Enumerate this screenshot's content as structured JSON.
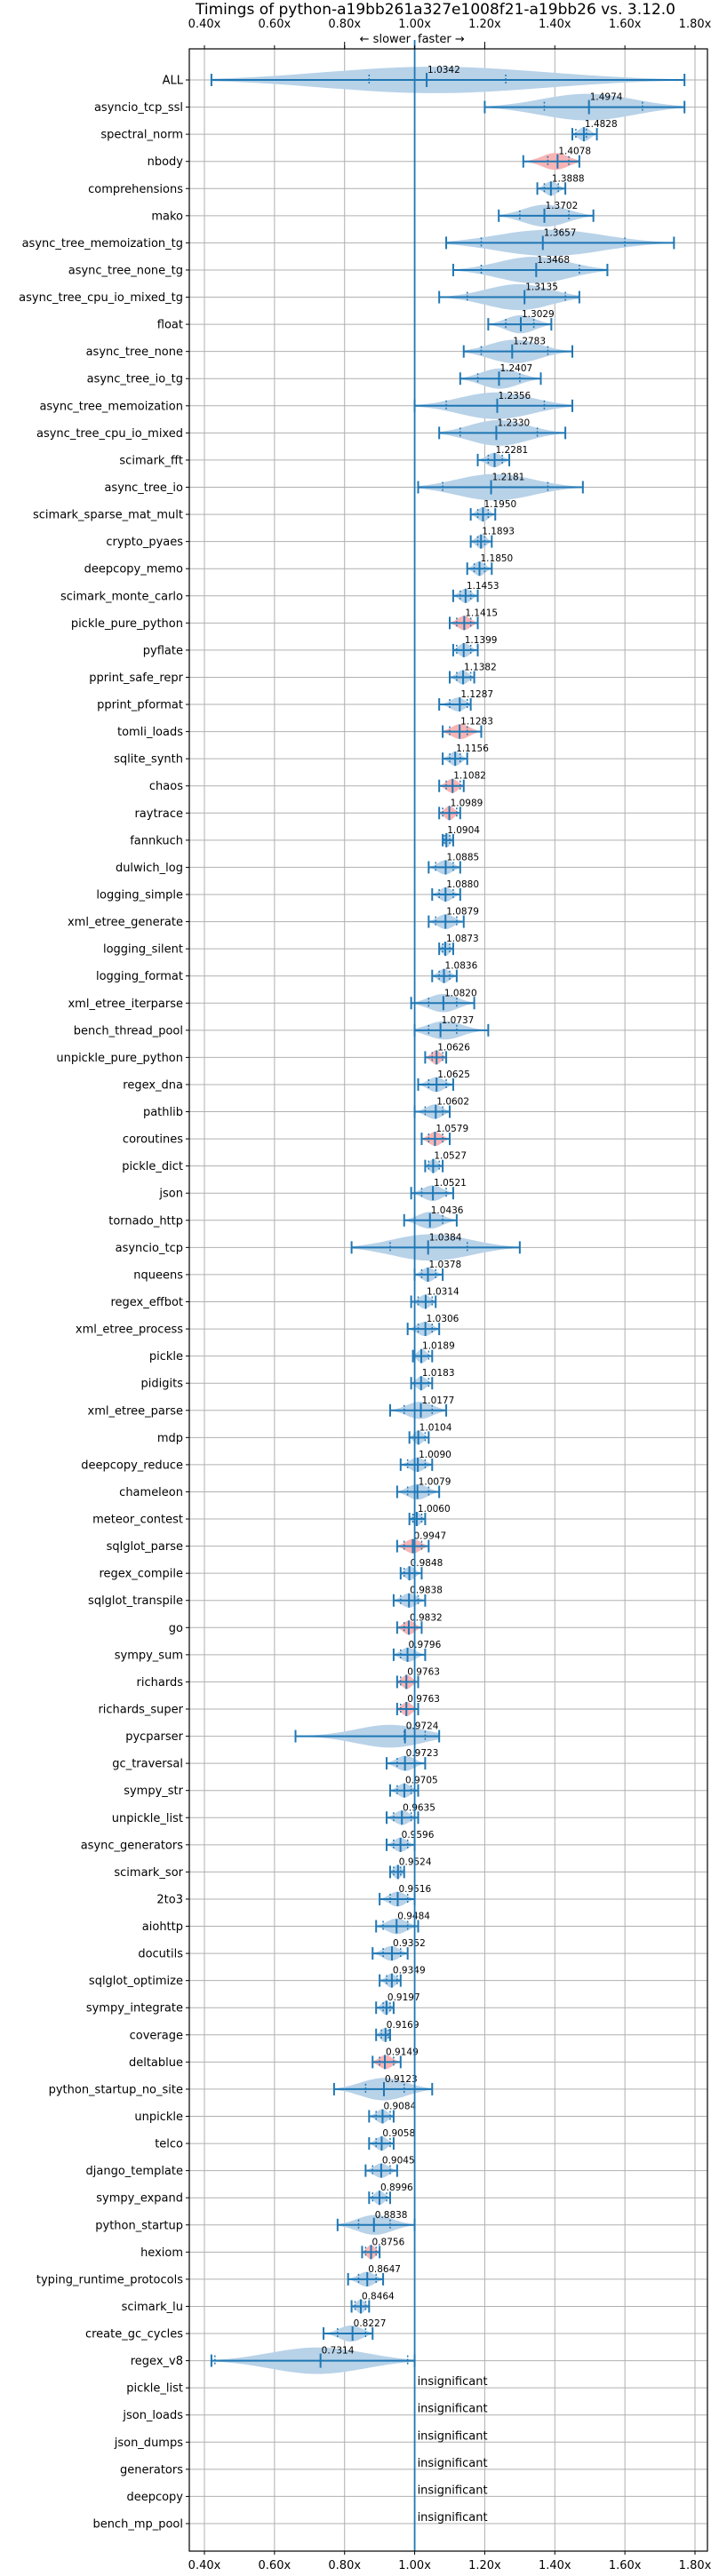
{
  "chart_data": {
    "type": "violin",
    "title": "Timings of python-a19bb261a327e1008f21-a19bb26 vs. 3.12.0",
    "xlabel": "",
    "ylabel": "",
    "xlim": [
      0.35,
      1.84
    ],
    "x_ticks": [
      0.4,
      0.6,
      0.8,
      1.0,
      1.2,
      1.4,
      1.6,
      1.8
    ],
    "x_tick_labels": [
      "0.40x",
      "0.60x",
      "0.80x",
      "1.00x",
      "1.20x",
      "1.40x",
      "1.60x",
      "1.80x"
    ],
    "reference_line": 1.0,
    "direction_labels": {
      "slower": "← slower",
      "faster": "faster →"
    },
    "grid": true,
    "colors": {
      "line": "#1f77b4",
      "fill_normal": "#b8d2e8",
      "fill_highlight": "#f8b4b4"
    },
    "insignificant_text": "insignificant",
    "benchmarks": [
      {
        "name": "ALL",
        "median": 1.0342,
        "min": 0.42,
        "max": 1.77,
        "q1": 0.87,
        "q3": 1.26,
        "highlight": false
      },
      {
        "name": "asyncio_tcp_ssl",
        "median": 1.4974,
        "min": 1.2,
        "max": 1.77,
        "q1": 1.37,
        "q3": 1.65,
        "highlight": false
      },
      {
        "name": "spectral_norm",
        "median": 1.4828,
        "min": 1.45,
        "max": 1.52,
        "q1": 1.46,
        "q3": 1.49,
        "highlight": false
      },
      {
        "name": "nbody",
        "median": 1.4078,
        "min": 1.31,
        "max": 1.47,
        "q1": 1.38,
        "q3": 1.44,
        "highlight": true
      },
      {
        "name": "comprehensions",
        "median": 1.3888,
        "min": 1.35,
        "max": 1.43,
        "q1": 1.37,
        "q3": 1.41,
        "highlight": false
      },
      {
        "name": "mako",
        "median": 1.3702,
        "min": 1.24,
        "max": 1.51,
        "q1": 1.3,
        "q3": 1.44,
        "highlight": false
      },
      {
        "name": "async_tree_memoization_tg",
        "median": 1.3657,
        "min": 1.09,
        "max": 1.74,
        "q1": 1.19,
        "q3": 1.6,
        "highlight": false
      },
      {
        "name": "async_tree_none_tg",
        "median": 1.3468,
        "min": 1.11,
        "max": 1.55,
        "q1": 1.19,
        "q3": 1.47,
        "highlight": false
      },
      {
        "name": "async_tree_cpu_io_mixed_tg",
        "median": 1.3135,
        "min": 1.07,
        "max": 1.47,
        "q1": 1.15,
        "q3": 1.43,
        "highlight": false
      },
      {
        "name": "float",
        "median": 1.3029,
        "min": 1.21,
        "max": 1.39,
        "q1": 1.26,
        "q3": 1.34,
        "highlight": false
      },
      {
        "name": "async_tree_none",
        "median": 1.2783,
        "min": 1.14,
        "max": 1.45,
        "q1": 1.19,
        "q3": 1.38,
        "highlight": false
      },
      {
        "name": "async_tree_io_tg",
        "median": 1.2407,
        "min": 1.13,
        "max": 1.36,
        "q1": 1.18,
        "q3": 1.3,
        "highlight": false
      },
      {
        "name": "async_tree_memoization",
        "median": 1.2356,
        "min": 1.0,
        "max": 1.45,
        "q1": 1.09,
        "q3": 1.37,
        "highlight": false
      },
      {
        "name": "async_tree_cpu_io_mixed",
        "median": 1.233,
        "min": 1.07,
        "max": 1.43,
        "q1": 1.13,
        "q3": 1.35,
        "highlight": false
      },
      {
        "name": "scimark_fft",
        "median": 1.2281,
        "min": 1.18,
        "max": 1.27,
        "q1": 1.21,
        "q3": 1.25,
        "highlight": false
      },
      {
        "name": "async_tree_io",
        "median": 1.2181,
        "min": 1.01,
        "max": 1.48,
        "q1": 1.08,
        "q3": 1.38,
        "highlight": false
      },
      {
        "name": "scimark_sparse_mat_mult",
        "median": 1.195,
        "min": 1.16,
        "max": 1.23,
        "q1": 1.18,
        "q3": 1.21,
        "highlight": false
      },
      {
        "name": "crypto_pyaes",
        "median": 1.1893,
        "min": 1.16,
        "max": 1.22,
        "q1": 1.18,
        "q3": 1.2,
        "highlight": false
      },
      {
        "name": "deepcopy_memo",
        "median": 1.185,
        "min": 1.15,
        "max": 1.22,
        "q1": 1.17,
        "q3": 1.2,
        "highlight": false
      },
      {
        "name": "scimark_monte_carlo",
        "median": 1.1453,
        "min": 1.11,
        "max": 1.18,
        "q1": 1.13,
        "q3": 1.16,
        "highlight": false
      },
      {
        "name": "pickle_pure_python",
        "median": 1.1415,
        "min": 1.1,
        "max": 1.18,
        "q1": 1.12,
        "q3": 1.16,
        "highlight": true
      },
      {
        "name": "pyflate",
        "median": 1.1399,
        "min": 1.11,
        "max": 1.18,
        "q1": 1.12,
        "q3": 1.16,
        "highlight": false
      },
      {
        "name": "pprint_safe_repr",
        "median": 1.1382,
        "min": 1.1,
        "max": 1.17,
        "q1": 1.12,
        "q3": 1.16,
        "highlight": false
      },
      {
        "name": "pprint_pformat",
        "median": 1.1287,
        "min": 1.07,
        "max": 1.16,
        "q1": 1.1,
        "q3": 1.15,
        "highlight": false
      },
      {
        "name": "tomli_loads",
        "median": 1.1283,
        "min": 1.08,
        "max": 1.19,
        "q1": 1.1,
        "q3": 1.15,
        "highlight": true
      },
      {
        "name": "sqlite_synth",
        "median": 1.1156,
        "min": 1.08,
        "max": 1.15,
        "q1": 1.1,
        "q3": 1.13,
        "highlight": false
      },
      {
        "name": "chaos",
        "median": 1.1082,
        "min": 1.07,
        "max": 1.14,
        "q1": 1.09,
        "q3": 1.13,
        "highlight": true
      },
      {
        "name": "raytrace",
        "median": 1.0989,
        "min": 1.07,
        "max": 1.13,
        "q1": 1.08,
        "q3": 1.12,
        "highlight": true
      },
      {
        "name": "fannkuch",
        "median": 1.0904,
        "min": 1.08,
        "max": 1.11,
        "q1": 1.085,
        "q3": 1.1,
        "highlight": false
      },
      {
        "name": "dulwich_log",
        "median": 1.0885,
        "min": 1.04,
        "max": 1.13,
        "q1": 1.06,
        "q3": 1.11,
        "highlight": false
      },
      {
        "name": "logging_simple",
        "median": 1.088,
        "min": 1.05,
        "max": 1.13,
        "q1": 1.07,
        "q3": 1.11,
        "highlight": false
      },
      {
        "name": "xml_etree_generate",
        "median": 1.0879,
        "min": 1.04,
        "max": 1.14,
        "q1": 1.06,
        "q3": 1.12,
        "highlight": false
      },
      {
        "name": "logging_silent",
        "median": 1.0873,
        "min": 1.07,
        "max": 1.11,
        "q1": 1.08,
        "q3": 1.1,
        "highlight": false
      },
      {
        "name": "logging_format",
        "median": 1.0836,
        "min": 1.05,
        "max": 1.12,
        "q1": 1.07,
        "q3": 1.1,
        "highlight": false
      },
      {
        "name": "xml_etree_iterparse",
        "median": 1.082,
        "min": 0.99,
        "max": 1.17,
        "q1": 1.04,
        "q3": 1.12,
        "highlight": false
      },
      {
        "name": "bench_thread_pool",
        "median": 1.0737,
        "min": 1.0,
        "max": 1.21,
        "q1": 1.04,
        "q3": 1.12,
        "highlight": false
      },
      {
        "name": "unpickle_pure_python",
        "median": 1.0626,
        "min": 1.03,
        "max": 1.09,
        "q1": 1.05,
        "q3": 1.08,
        "highlight": true
      },
      {
        "name": "regex_dna",
        "median": 1.0625,
        "min": 1.01,
        "max": 1.11,
        "q1": 1.04,
        "q3": 1.09,
        "highlight": false
      },
      {
        "name": "pathlib",
        "median": 1.0602,
        "min": 1.0,
        "max": 1.1,
        "q1": 1.03,
        "q3": 1.08,
        "highlight": false
      },
      {
        "name": "coroutines",
        "median": 1.0579,
        "min": 1.02,
        "max": 1.1,
        "q1": 1.04,
        "q3": 1.08,
        "highlight": true
      },
      {
        "name": "pickle_dict",
        "median": 1.0527,
        "min": 1.03,
        "max": 1.08,
        "q1": 1.04,
        "q3": 1.07,
        "highlight": false
      },
      {
        "name": "json",
        "median": 1.0521,
        "min": 0.99,
        "max": 1.11,
        "q1": 1.02,
        "q3": 1.09,
        "highlight": false
      },
      {
        "name": "tornado_http",
        "median": 1.0436,
        "min": 0.97,
        "max": 1.12,
        "q1": 1.0,
        "q3": 1.08,
        "highlight": false
      },
      {
        "name": "asyncio_tcp",
        "median": 1.0384,
        "min": 0.82,
        "max": 1.3,
        "q1": 0.93,
        "q3": 1.15,
        "highlight": false
      },
      {
        "name": "nqueens",
        "median": 1.0378,
        "min": 1.0,
        "max": 1.08,
        "q1": 1.02,
        "q3": 1.06,
        "highlight": false
      },
      {
        "name": "regex_effbot",
        "median": 1.0314,
        "min": 0.99,
        "max": 1.06,
        "q1": 1.01,
        "q3": 1.05,
        "highlight": false
      },
      {
        "name": "xml_etree_process",
        "median": 1.0306,
        "min": 0.98,
        "max": 1.07,
        "q1": 1.01,
        "q3": 1.05,
        "highlight": false
      },
      {
        "name": "pickle",
        "median": 1.0189,
        "min": 0.995,
        "max": 1.05,
        "q1": 1.0,
        "q3": 1.04,
        "highlight": false
      },
      {
        "name": "pidigits",
        "median": 1.0183,
        "min": 0.99,
        "max": 1.05,
        "q1": 1.0,
        "q3": 1.04,
        "highlight": false
      },
      {
        "name": "xml_etree_parse",
        "median": 1.0177,
        "min": 0.93,
        "max": 1.09,
        "q1": 0.97,
        "q3": 1.05,
        "highlight": false
      },
      {
        "name": "mdp",
        "median": 1.0104,
        "min": 0.985,
        "max": 1.04,
        "q1": 1.0,
        "q3": 1.03,
        "highlight": false
      },
      {
        "name": "deepcopy_reduce",
        "median": 1.009,
        "min": 0.96,
        "max": 1.05,
        "q1": 0.98,
        "q3": 1.03,
        "highlight": false
      },
      {
        "name": "chameleon",
        "median": 1.0079,
        "min": 0.95,
        "max": 1.07,
        "q1": 0.98,
        "q3": 1.04,
        "highlight": false
      },
      {
        "name": "meteor_contest",
        "median": 1.006,
        "min": 0.985,
        "max": 1.03,
        "q1": 0.995,
        "q3": 1.02,
        "highlight": false
      },
      {
        "name": "sqlglot_parse",
        "median": 0.9947,
        "min": 0.95,
        "max": 1.04,
        "q1": 0.97,
        "q3": 1.02,
        "highlight": true
      },
      {
        "name": "regex_compile",
        "median": 0.9848,
        "min": 0.96,
        "max": 1.02,
        "q1": 0.97,
        "q3": 1.0,
        "highlight": false
      },
      {
        "name": "sqlglot_transpile",
        "median": 0.9838,
        "min": 0.94,
        "max": 1.03,
        "q1": 0.96,
        "q3": 1.01,
        "highlight": false
      },
      {
        "name": "go",
        "median": 0.9832,
        "min": 0.95,
        "max": 1.02,
        "q1": 0.97,
        "q3": 1.0,
        "highlight": true
      },
      {
        "name": "sympy_sum",
        "median": 0.9796,
        "min": 0.94,
        "max": 1.03,
        "q1": 0.96,
        "q3": 1.0,
        "highlight": false
      },
      {
        "name": "richards",
        "median": 0.9763,
        "min": 0.95,
        "max": 1.01,
        "q1": 0.96,
        "q3": 1.0,
        "highlight": true
      },
      {
        "name": "richards_super",
        "median": 0.9763,
        "min": 0.95,
        "max": 1.01,
        "q1": 0.96,
        "q3": 1.0,
        "highlight": true
      },
      {
        "name": "pycparser",
        "median": 0.9724,
        "min": 0.66,
        "max": 1.07,
        "q1": 0.97,
        "q3": 1.03,
        "highlight": false
      },
      {
        "name": "gc_traversal",
        "median": 0.9723,
        "min": 0.92,
        "max": 1.03,
        "q1": 0.95,
        "q3": 1.0,
        "highlight": false
      },
      {
        "name": "sympy_str",
        "median": 0.9705,
        "min": 0.93,
        "max": 1.01,
        "q1": 0.95,
        "q3": 0.99,
        "highlight": false
      },
      {
        "name": "unpickle_list",
        "median": 0.9635,
        "min": 0.92,
        "max": 1.01,
        "q1": 0.94,
        "q3": 0.99,
        "highlight": false
      },
      {
        "name": "async_generators",
        "median": 0.9596,
        "min": 0.92,
        "max": 1.0,
        "q1": 0.94,
        "q3": 0.98,
        "highlight": false
      },
      {
        "name": "scimark_sor",
        "median": 0.9524,
        "min": 0.93,
        "max": 0.97,
        "q1": 0.94,
        "q3": 0.96,
        "highlight": false
      },
      {
        "name": "2to3",
        "median": 0.9516,
        "min": 0.9,
        "max": 1.0,
        "q1": 0.93,
        "q3": 0.98,
        "highlight": false
      },
      {
        "name": "aiohttp",
        "median": 0.9484,
        "min": 0.89,
        "max": 1.01,
        "q1": 0.91,
        "q3": 0.98,
        "highlight": false
      },
      {
        "name": "docutils",
        "median": 0.9352,
        "min": 0.88,
        "max": 0.98,
        "q1": 0.91,
        "q3": 0.96,
        "highlight": false
      },
      {
        "name": "sqlglot_optimize",
        "median": 0.9349,
        "min": 0.9,
        "max": 0.96,
        "q1": 0.92,
        "q3": 0.95,
        "highlight": false
      },
      {
        "name": "sympy_integrate",
        "median": 0.9197,
        "min": 0.89,
        "max": 0.94,
        "q1": 0.91,
        "q3": 0.93,
        "highlight": false
      },
      {
        "name": "coverage",
        "median": 0.9169,
        "min": 0.89,
        "max": 0.93,
        "q1": 0.905,
        "q3": 0.925,
        "highlight": false
      },
      {
        "name": "deltablue",
        "median": 0.9149,
        "min": 0.88,
        "max": 0.96,
        "q1": 0.9,
        "q3": 0.94,
        "highlight": true
      },
      {
        "name": "python_startup_no_site",
        "median": 0.9123,
        "min": 0.77,
        "max": 1.05,
        "q1": 0.86,
        "q3": 0.97,
        "highlight": false
      },
      {
        "name": "unpickle",
        "median": 0.9084,
        "min": 0.87,
        "max": 0.94,
        "q1": 0.89,
        "q3": 0.93,
        "highlight": false
      },
      {
        "name": "telco",
        "median": 0.9058,
        "min": 0.87,
        "max": 0.94,
        "q1": 0.89,
        "q3": 0.93,
        "highlight": false
      },
      {
        "name": "django_template",
        "median": 0.9045,
        "min": 0.86,
        "max": 0.95,
        "q1": 0.88,
        "q3": 0.93,
        "highlight": false
      },
      {
        "name": "sympy_expand",
        "median": 0.8996,
        "min": 0.87,
        "max": 0.93,
        "q1": 0.88,
        "q3": 0.92,
        "highlight": false
      },
      {
        "name": "python_startup",
        "median": 0.8838,
        "min": 0.78,
        "max": 1.0,
        "q1": 0.84,
        "q3": 0.93,
        "highlight": false
      },
      {
        "name": "hexiom",
        "median": 0.8756,
        "min": 0.85,
        "max": 0.9,
        "q1": 0.86,
        "q3": 0.89,
        "highlight": true
      },
      {
        "name": "typing_runtime_protocols",
        "median": 0.8647,
        "min": 0.81,
        "max": 0.91,
        "q1": 0.84,
        "q3": 0.89,
        "highlight": false
      },
      {
        "name": "scimark_lu",
        "median": 0.8464,
        "min": 0.82,
        "max": 0.87,
        "q1": 0.83,
        "q3": 0.86,
        "highlight": false
      },
      {
        "name": "create_gc_cycles",
        "median": 0.8227,
        "min": 0.74,
        "max": 0.88,
        "q1": 0.78,
        "q3": 0.86,
        "highlight": false
      },
      {
        "name": "regex_v8",
        "median": 0.7314,
        "min": 0.42,
        "max": 1.0,
        "q1": 0.43,
        "q3": 0.98,
        "highlight": false
      },
      {
        "name": "pickle_list",
        "median": null,
        "insignificant": true
      },
      {
        "name": "json_loads",
        "median": null,
        "insignificant": true
      },
      {
        "name": "json_dumps",
        "median": null,
        "insignificant": true
      },
      {
        "name": "generators",
        "median": null,
        "insignificant": true
      },
      {
        "name": "deepcopy",
        "median": null,
        "insignificant": true
      },
      {
        "name": "bench_mp_pool",
        "median": null,
        "insignificant": true
      }
    ]
  }
}
